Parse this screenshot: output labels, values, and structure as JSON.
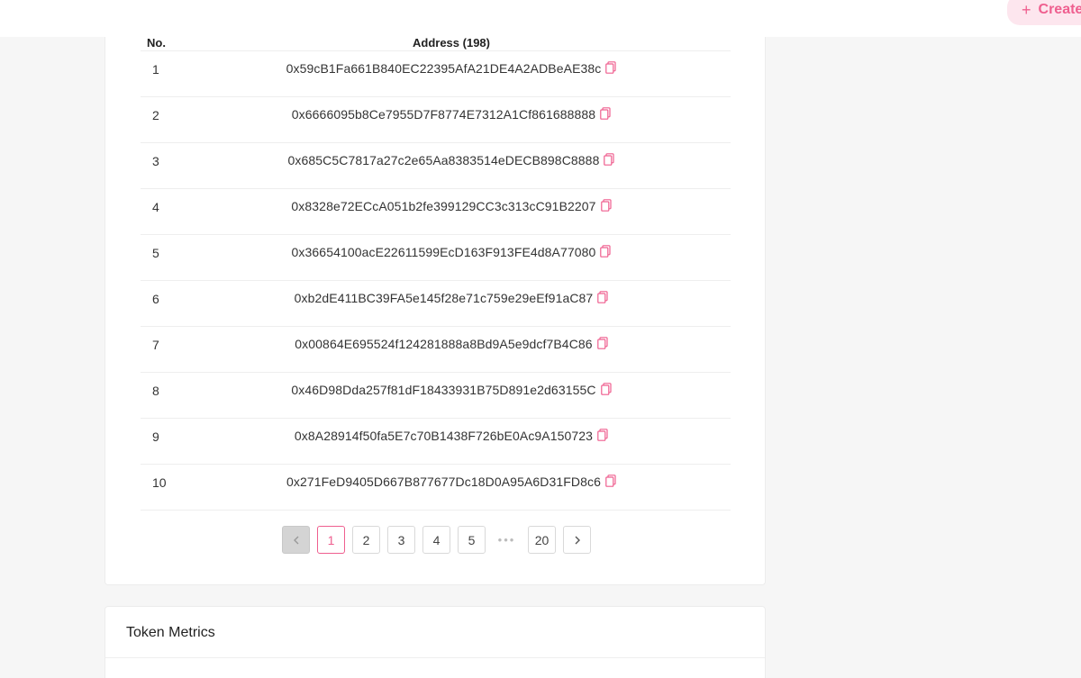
{
  "header": {
    "create_label": "Create",
    "accent_color": "#ef5f8f"
  },
  "holders_table": {
    "col_no": "No.",
    "col_address": "Address (198)",
    "rows": [
      {
        "no": "1",
        "address": "0x59cB1Fa661B840EC22395AfA21DE4A2ADBeAE38c"
      },
      {
        "no": "2",
        "address": "0x6666095b8Ce7955D7F8774E7312A1Cf861688888"
      },
      {
        "no": "3",
        "address": "0x685C5C7817a27c2e65Aa8383514eDECB898C8888"
      },
      {
        "no": "4",
        "address": "0x8328e72ECcA051b2fe399129CC3c313cC91B2207"
      },
      {
        "no": "5",
        "address": "0x36654100acE22611599EcD163F913FE4d8A77080"
      },
      {
        "no": "6",
        "address": "0xb2dE411BC39FA5e145f28e71c759e29eEf91aC87"
      },
      {
        "no": "7",
        "address": "0x00864E695524f124281888a8Bd9A5e9dcf7B4C86"
      },
      {
        "no": "8",
        "address": "0x46D98Dda257f81dF18433931B75D891e2d63155C"
      },
      {
        "no": "9",
        "address": "0x8A28914f50fa5E7c70B1438F726bE0Ac9A150723"
      },
      {
        "no": "10",
        "address": "0x271FeD9405D667B877677Dc18D0A95A6D31FD8c6"
      }
    ]
  },
  "pagination": {
    "pages": [
      "1",
      "2",
      "3",
      "4",
      "5"
    ],
    "ellipsis": "•••",
    "last": "20",
    "current": "1"
  },
  "token_metrics": {
    "title": "Token Metrics"
  }
}
